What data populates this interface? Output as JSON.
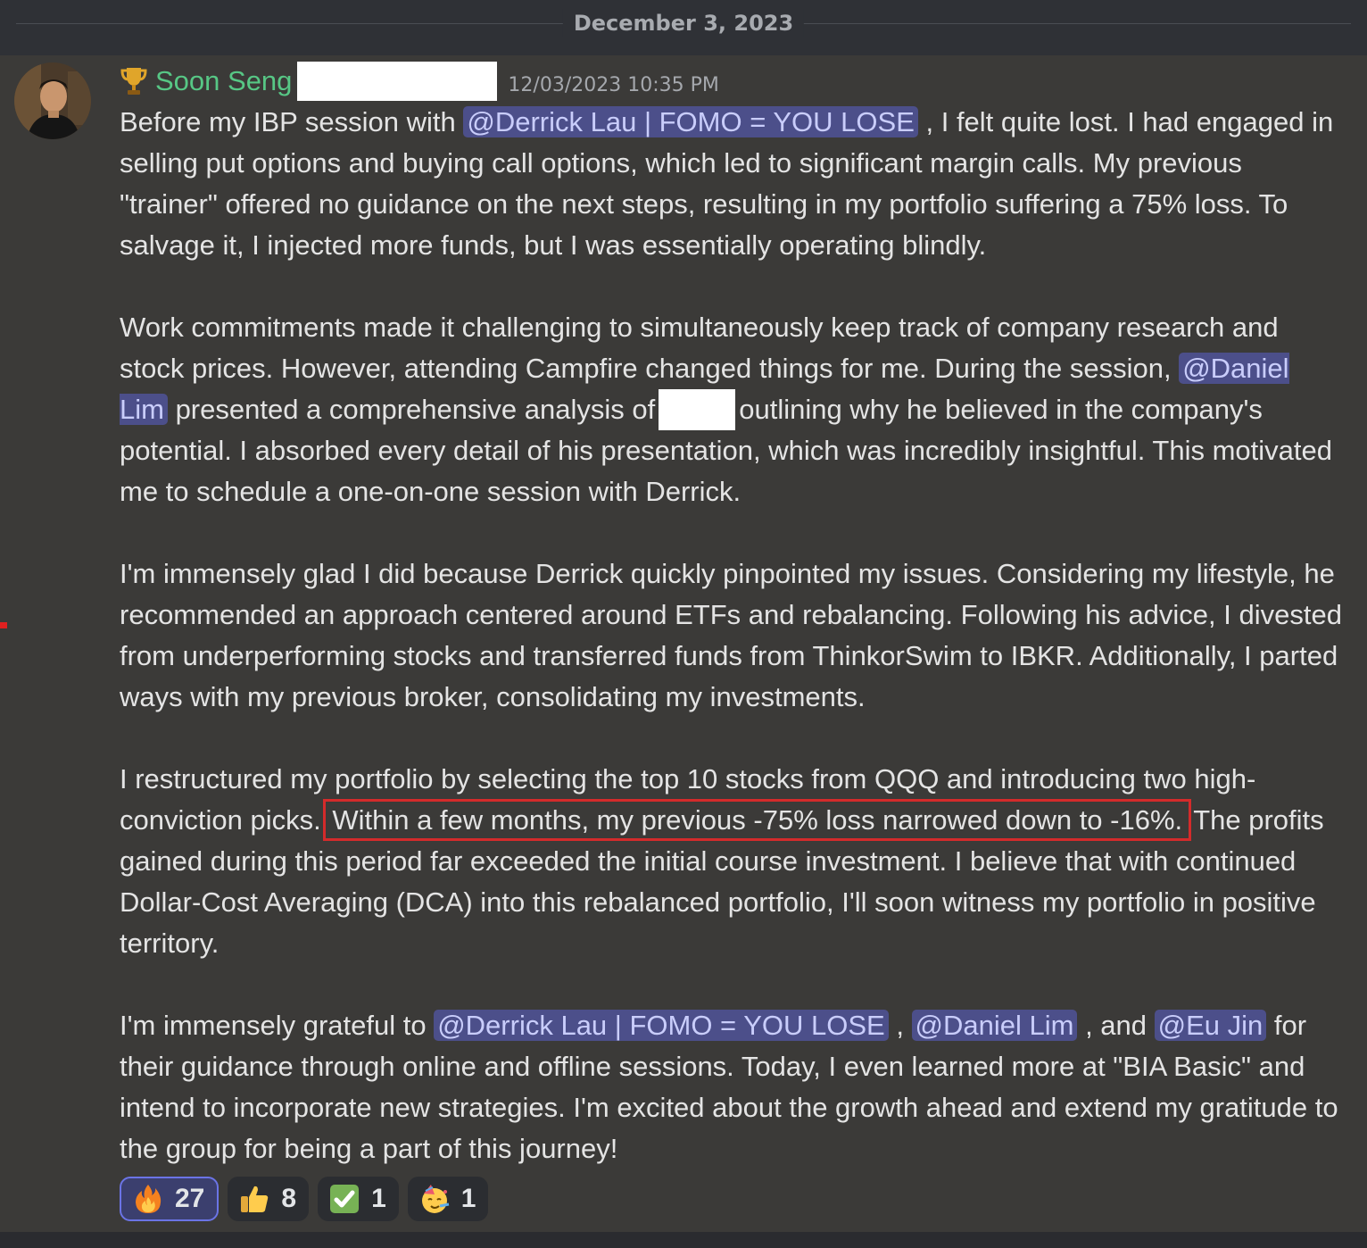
{
  "date_divider": "December 3, 2023",
  "message": {
    "author": "Soon Seng",
    "badge_icon": "trophy-icon",
    "timestamp": "12/03/2023 10:35 PM",
    "p1": {
      "t1": "Before my IBP session with ",
      "m1": "@Derrick Lau | FOMO = YOU LOSE",
      "t2": " , I felt quite lost. I had engaged in selling put options and buying call options, which led to significant margin calls. My previous \"trainer\" offered no guidance on the next steps, resulting in my portfolio suffering a 75% loss. To salvage it, I injected more funds, but I was essentially operating blindly."
    },
    "p2": {
      "t1": "Work commitments made it challenging to simultaneously keep track of company research and stock prices. However, attending Campfire changed things for me. During the session, ",
      "m1": "@Daniel Lim",
      "t2": "  presented a comprehensive analysis of",
      "t3": "outlining why he believed in the company's potential. I absorbed every detail of his presentation, which was incredibly insightful. This motivated me to schedule a one-on-one session with Derrick."
    },
    "p3": {
      "t1": "I'm immensely glad I did because Derrick quickly pinpointed my issues. Considering my lifestyle, he recommended an approach centered around ETFs and rebalancing. Following his advice, I divested from underperforming stocks and transferred funds from ThinkorSwim to IBKR. Additionally, I parted ways with my previous broker, consolidating my investments."
    },
    "p4": {
      "t1": "I restructured my portfolio by selecting the top 10 stocks from QQQ and introducing two high-conviction picks.",
      "highlight": "Within a few months, my previous -75% loss narrowed down to -16%.",
      "t2": "The profits gained during this period far exceeded the initial course investment. I believe that with continued Dollar-Cost Averaging (DCA) into this rebalanced portfolio, I'll soon witness my portfolio in positive territory."
    },
    "p5": {
      "t1": "I'm immensely grateful to ",
      "m1": "@Derrick Lau | FOMO = YOU LOSE",
      "t2": " , ",
      "m2": "@Daniel Lim",
      "t3": " , and ",
      "m3": "@Eu Jin",
      "t4": " for their guidance through online and offline sessions. Today, I even learned more at \"BIA Basic\" and intend to incorporate new strategies. I'm excited about the growth ahead and extend my gratitude to the group for being a part of this journey!"
    }
  },
  "reactions": [
    {
      "icon": "fire-icon",
      "count": "27",
      "active": true
    },
    {
      "icon": "thumbs-up-icon",
      "count": "8",
      "active": false
    },
    {
      "icon": "check-mark-icon",
      "count": "1",
      "active": false
    },
    {
      "icon": "partying-face-icon",
      "count": "1",
      "active": false
    }
  ],
  "colors": {
    "username": "#57c785",
    "mention_bg": "#4c4f8a",
    "mention_text": "#c9cdfb",
    "highlight_border": "#d42b2b",
    "active_reaction_border": "#6b74e6"
  }
}
